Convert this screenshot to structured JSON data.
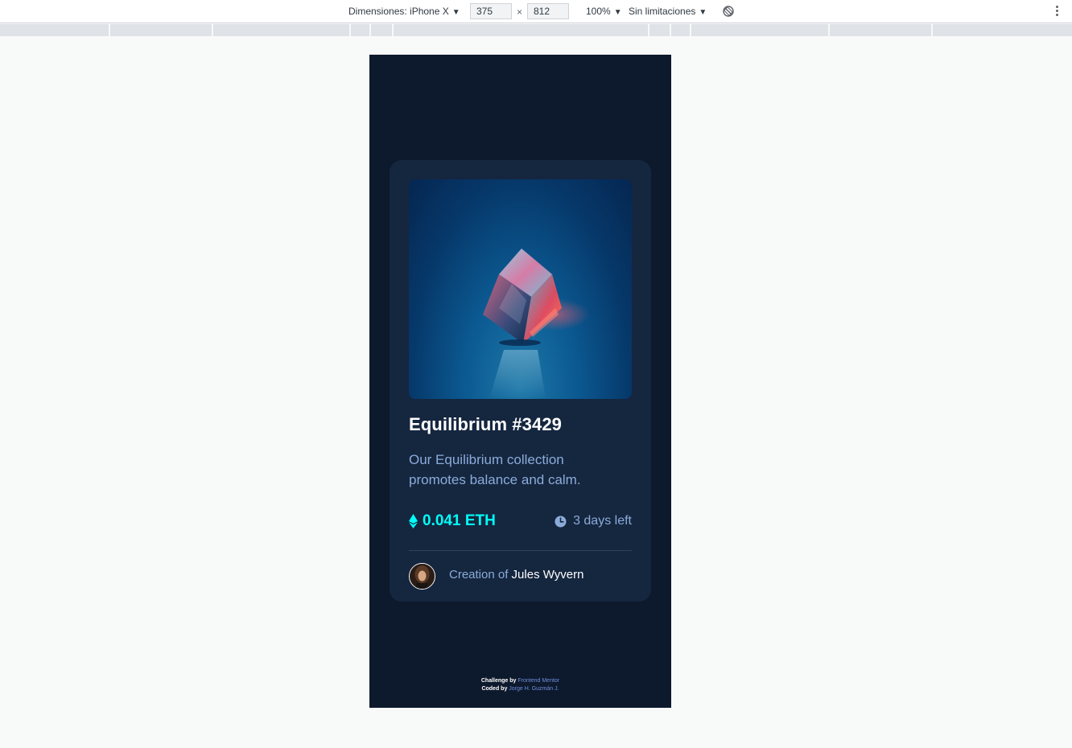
{
  "devtools": {
    "dimensions_label": "Dimensiones: iPhone X",
    "width": "375",
    "height": "812",
    "times": "×",
    "zoom": "100%",
    "throttling": "Sin limitaciones",
    "caret": "▼",
    "icons": {
      "rotate": "rotate-icon",
      "menu": "more-vert-icon"
    }
  },
  "card": {
    "image_alt": "Equilibrium crystal cube",
    "title": "Equilibrium #3429",
    "description": "Our Equilibrium collection promotes balance and calm.",
    "price": "0.041 ETH",
    "time_left": "3 days left",
    "creator_prefix": "Creation of",
    "creator_name": "Jules Wyvern"
  },
  "footer": {
    "challenge_prefix": "Challenge by",
    "challenge_link": "Frontend Mentor",
    "coded_prefix": "Coded by",
    "coded_link": "Jorge H. Guzmán J."
  },
  "colors": {
    "page_bg": "#0d192c",
    "card_bg": "#15263f",
    "accent_cyan": "#00fff8",
    "soft_blue": "#8bacda",
    "white": "#ffffff"
  }
}
